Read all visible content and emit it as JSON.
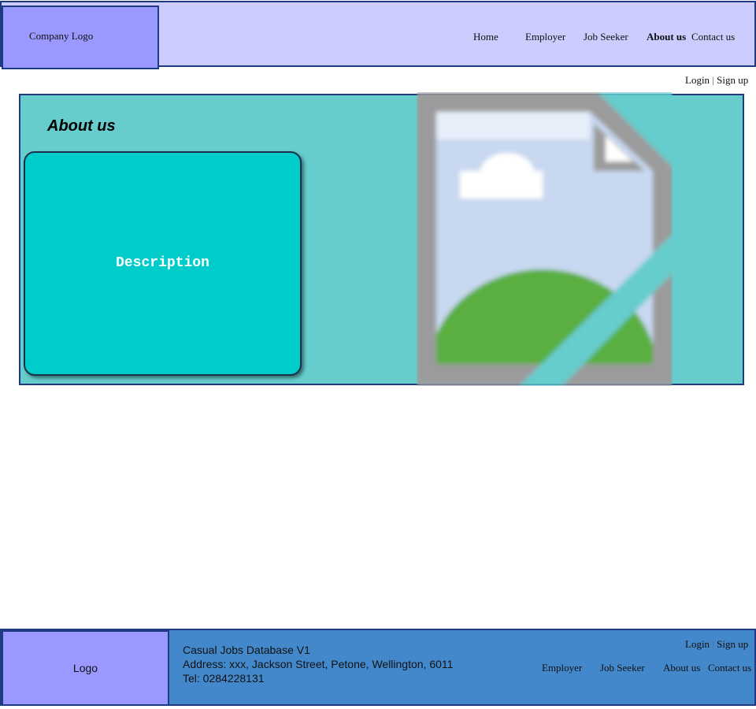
{
  "header": {
    "logo_text": "Company Logo",
    "nav": [
      {
        "label": "Home"
      },
      {
        "label": "Employer"
      },
      {
        "label": "Job Seeker"
      },
      {
        "label": "About us",
        "active": true
      },
      {
        "label": "Contact us"
      }
    ]
  },
  "auth": {
    "login": "Login",
    "separator": "|",
    "signup": "Sign up"
  },
  "main": {
    "title": "About us",
    "description_label": "Description"
  },
  "footer": {
    "logo_text": "Logo",
    "site_name": "Casual Jobs Database V1",
    "address": "Address: xxx, Jackson Street, Petone, Wellington, 6011",
    "tel": "Tel: 0284228131",
    "nav": [
      {
        "label": "Employer"
      },
      {
        "label": "Job Seeker"
      },
      {
        "label": "About us"
      },
      {
        "label": "Contact us"
      }
    ]
  },
  "colors": {
    "header_bg": "#ccccff",
    "logo_bg": "#9999ff",
    "banner_bg": "#66cccc",
    "card_bg": "#00cccc",
    "footer_bg": "#4488cc",
    "border": "#1f3a80"
  },
  "icons": {
    "broken_image": "broken-image-icon"
  }
}
